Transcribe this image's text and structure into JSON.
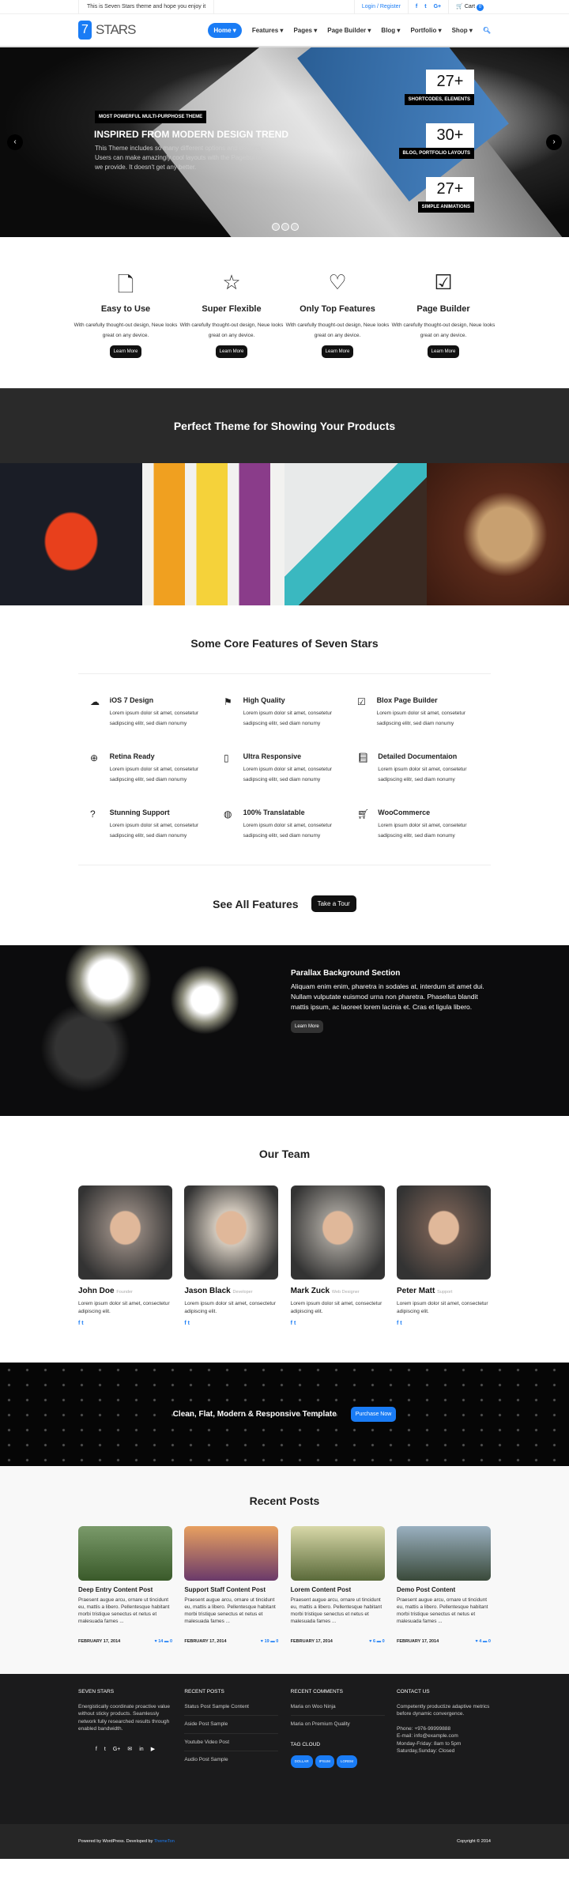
{
  "topbar": {
    "message": "This is Seven Stars theme and hope you enjoy it",
    "login": "Login / Register",
    "social": [
      "f",
      "t",
      "G+"
    ],
    "cart_label": "Cart",
    "cart_count": "0"
  },
  "header": {
    "logo_num": "7",
    "logo_text": "STARS",
    "nav": [
      "Home",
      "Features",
      "Pages",
      "Page Builder",
      "Blog",
      "Portfolio",
      "Shop"
    ]
  },
  "hero": {
    "tag": "MOST POWERFUL MULTI-PURPHOSE THEME",
    "title": "INSPIRED FROM MODERN DESIGN TREND",
    "text": "This Theme includes so many different options and designs. Users can make amazingly cool layouts with the Pagebuilder we provide. It doesn't get any better.",
    "stats": [
      {
        "n": "27+",
        "l": "SHORTCODES, ELEMENTS"
      },
      {
        "n": "30+",
        "l": "BLOG, PORTFOLIO LAYOUTS"
      },
      {
        "n": "27+",
        "l": "SIMPLE ANIMATIONS"
      }
    ]
  },
  "features": [
    {
      "icon": "file-icon",
      "t": "Easy to Use",
      "d": "With carefully thought-out design, Neue looks great on any device.",
      "b": "Learn More"
    },
    {
      "icon": "star-icon",
      "t": "Super Flexible",
      "d": "With carefully thought-out design, Neue looks great on any device.",
      "b": "Learn More"
    },
    {
      "icon": "heart-icon",
      "t": "Only Top Features",
      "d": "With carefully thought-out design, Neue looks great on any device.",
      "b": "Learn More"
    },
    {
      "icon": "check-square-icon",
      "t": "Page Builder",
      "d": "With carefully thought-out design, Neue looks great on any device.",
      "b": "Learn More"
    }
  ],
  "products": {
    "title": "Perfect Theme for Showing Your Products"
  },
  "core": {
    "title": "Some Core Features of Seven Stars",
    "items": [
      {
        "icon": "cloud-icon",
        "t": "iOS 7 Design",
        "d": "Lorem ipsum dolor sit amet, consetetur sadipscing elitr, sed diam nonumy"
      },
      {
        "icon": "flag-icon",
        "t": "High Quality",
        "d": "Lorem ipsum dolor sit amet, consetetur sadipscing elitr, sed diam nonumy"
      },
      {
        "icon": "check-square-icon",
        "t": "Blox Page Builder",
        "d": "Lorem ipsum dolor sit amet, consetetur sadipscing elitr, sed diam nonumy"
      },
      {
        "icon": "zoom-in-icon",
        "t": "Retina Ready",
        "d": "Lorem ipsum dolor sit amet, consetetur sadipscing elitr, sed diam nonumy"
      },
      {
        "icon": "tablet-icon",
        "t": "Ultra Responsive",
        "d": "Lorem ipsum dolor sit amet, consetetur sadipscing elitr, sed diam nonumy"
      },
      {
        "icon": "book-icon",
        "t": "Detailed Documentaion",
        "d": "Lorem ipsum dolor sit amet, consetetur sadipscing elitr, sed diam nonumy"
      },
      {
        "icon": "question-circle-icon",
        "t": "Stunning Support",
        "d": "Lorem ipsum dolor sit amet, consetetur sadipscing elitr, sed diam nonumy"
      },
      {
        "icon": "globe-icon",
        "t": "100% Translatable",
        "d": "Lorem ipsum dolor sit amet, consetetur sadipscing elitr, sed diam nonumy"
      },
      {
        "icon": "cart-icon",
        "t": "WooCommerce",
        "d": "Lorem ipsum dolor sit amet, consetetur sadipscing elitr, sed diam nonumy"
      }
    ]
  },
  "see_all": {
    "title": "See All Features",
    "button": "Take a Tour"
  },
  "parallax": {
    "title": "Parallax Background Section",
    "text": "Aliquam enim enim, pharetra in sodales at, interdum sit amet dui. Nullam vulputate euismod urna non pharetra. Phasellus blandit mattis ipsum, ac laoreet lorem lacinia et. Cras et ligula libero.",
    "button": "Learn More"
  },
  "team": {
    "title": "Our Team",
    "members": [
      {
        "name": "John Doe",
        "role": "Founder",
        "bio": "Lorem ipsum dolor sit amet, consectetur adipiscing elit."
      },
      {
        "name": "Jason Black",
        "role": "Developer",
        "bio": "Lorem ipsum dolor sit amet, consectetur adipiscing elit."
      },
      {
        "name": "Mark Zuck",
        "role": "Web Designer",
        "bio": "Lorem ipsum dolor sit amet, consectetur adipiscing elit."
      },
      {
        "name": "Peter Matt",
        "role": "Support",
        "bio": "Lorem ipsum dolor sit amet, consectetur adipiscing elit."
      }
    ]
  },
  "cta": {
    "text": "Clean, Flat, Modern & Responsive Template",
    "button": "Purchase Now"
  },
  "posts": {
    "title": "Recent Posts",
    "items": [
      {
        "t": "Deep Entry Content Post",
        "d": "Praesent augue arcu, ornare ut tincidunt eu, mattis a libero. Pellentesque habitant morbi tristique senectus et netus et malesuada fames ...",
        "date": "FEBRUARY 17, 2014",
        "likes": "14",
        "comments": "0"
      },
      {
        "t": "Support Staff Content Post",
        "d": "Praesent augue arcu, ornare ut tincidunt eu, mattis a libero. Pellentesque habitant morbi tristique senectus et netus et malesuada fames ...",
        "date": "FEBRUARY 17, 2014",
        "likes": "19",
        "comments": "0"
      },
      {
        "t": "Lorem Content Post",
        "d": "Praesent augue arcu, ornare ut tincidunt eu, mattis a libero. Pellentesque habitant morbi tristique senectus et netus et malesuada fames ...",
        "date": "FEBRUARY 17, 2014",
        "likes": "6",
        "comments": "0"
      },
      {
        "t": "Demo Post Content",
        "d": "Praesent augue arcu, ornare ut tincidunt eu, mattis a libero. Pellentesque habitant morbi tristique senectus et netus et malesuada fames ...",
        "date": "FEBRUARY 17, 2014",
        "likes": "4",
        "comments": "0"
      }
    ]
  },
  "footer": {
    "about_title": "SEVEN STARS",
    "about": "Energistically coordinate proactive value without sticky products. Seamlessly network fully researched results through enabled bandwidth.",
    "social": [
      "f",
      "t",
      "G+",
      "✉",
      "in",
      "▶"
    ],
    "recent_title": "RECENT POSTS",
    "recent": [
      "Status Post Sample Content",
      "Aside Post Sample",
      "Youtube Video Post",
      "Audio Post Sample"
    ],
    "comments_title": "RECENT COMMENTS",
    "comments": [
      "Maria on Woo Ninja",
      "Maria on Premium Quality"
    ],
    "tag_title": "TAG CLOUD",
    "tags": [
      "DOLLAR",
      "IPSUM",
      "LOREM"
    ],
    "contact_title": "CONTACT US",
    "contact": "Competently productize adaptive metrics before dynamic convergence.",
    "phone": "Phone: +976-99999888",
    "email": "E-mail: info@example.com",
    "hours1": "Monday-Friday: 8am to 5pm",
    "hours2": "Saturday,Sunday: Closed"
  },
  "bottom": {
    "powered": "Powered by WordPress. Developed by ",
    "dev": "ThemeTon",
    "copyright": "Copyright © 2014"
  },
  "colors": {
    "accent": "#1a7cf5",
    "dark": "#1b1b1c"
  }
}
